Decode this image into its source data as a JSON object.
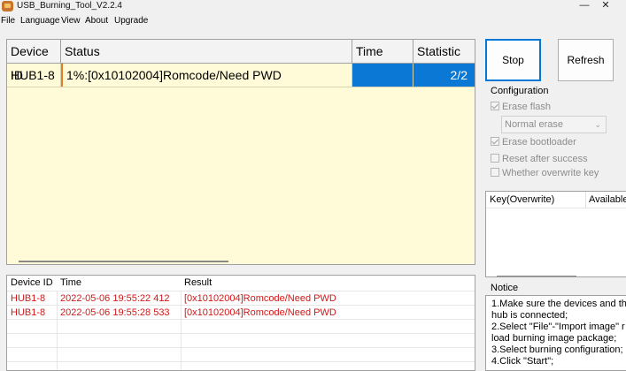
{
  "window": {
    "title": "USB_Burning_Tool_V2.2.4",
    "minimize_glyph": "—",
    "close_glyph": "✕",
    "icon": "app-icon"
  },
  "menu": {
    "items": [
      "File",
      "Language",
      "View",
      "About",
      "Upgrade"
    ]
  },
  "device_grid": {
    "headers": [
      "Device ID",
      "Status",
      "Time",
      "Statistic"
    ],
    "rows": [
      {
        "device_id": "HUB1-8",
        "status": "1%:[0x10102004]Romcode/Need PWD",
        "time": "",
        "statistic": "2/2"
      }
    ]
  },
  "log": {
    "headers": [
      "Device ID",
      "Time",
      "Result"
    ],
    "rows": [
      {
        "device_id": "HUB1-8",
        "time": "2022-05-06 19:55:22 412",
        "result": "[0x10102004]Romcode/Need PWD"
      },
      {
        "device_id": "HUB1-8",
        "time": "2022-05-06 19:55:28 533",
        "result": "[0x10102004]Romcode/Need PWD"
      }
    ]
  },
  "buttons": {
    "stop": "Stop",
    "refresh": "Refresh"
  },
  "configuration": {
    "label": "Configuration",
    "erase_flash": "Erase flash",
    "erase_mode": "Normal erase",
    "erase_bootloader": "Erase bootloader",
    "reset_after_success": "Reset after success",
    "whether_overwrite_key": "Whether overwrite key",
    "erase_flash_checked": true,
    "erase_bootloader_checked": true,
    "reset_after_success_checked": false,
    "whether_overwrite_key_checked": false
  },
  "key_panel": {
    "headers": [
      "Key(Overwrite)",
      "Available"
    ]
  },
  "notice": {
    "label": "Notice",
    "lines": [
      "1.Make sure the devices and th",
      "hub is connected;",
      "2.Select \"File\"-\"Import image\" r",
      "load burning image package;",
      "3.Select burning configuration;",
      "4.Click \"Start\";"
    ]
  },
  "colors": {
    "selected_cell": "#0a78d4",
    "grid_background": "#fffbd8",
    "log_error_text": "#d01818",
    "focus_border": "#0078d7"
  }
}
